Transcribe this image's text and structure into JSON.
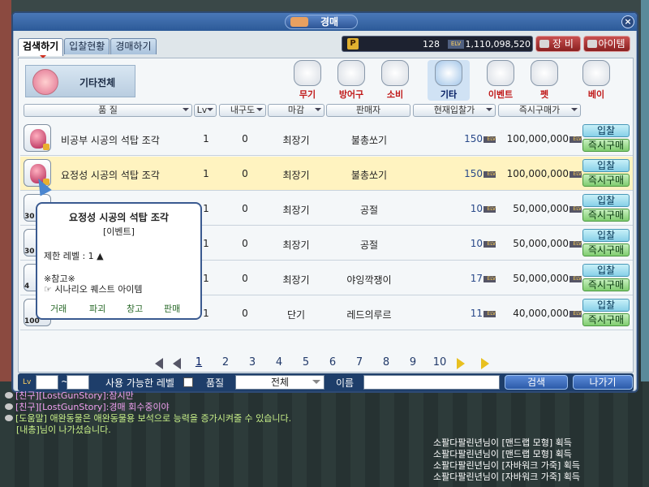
{
  "window": {
    "title": "경매"
  },
  "tabs": [
    {
      "label": "검색하기",
      "active": true
    },
    {
      "label": "입찰현황",
      "active": false
    },
    {
      "label": "경매하기",
      "active": false
    }
  ],
  "currency": {
    "pc_label": "P",
    "pc_value": "128",
    "meso_label": "ELV",
    "meso_value": "1,110,098,520"
  },
  "top_buttons": {
    "equip": "장 비",
    "item": "아이템"
  },
  "category_current": "기타전체",
  "categories": [
    {
      "label": "무기",
      "selected": false
    },
    {
      "label": "방어구",
      "selected": false
    },
    {
      "label": "소비",
      "selected": false
    },
    {
      "label": "기타",
      "selected": true
    },
    {
      "label": "이벤트",
      "selected": false
    },
    {
      "label": "펫",
      "selected": false
    },
    {
      "label": "베이",
      "selected": false
    }
  ],
  "columns": {
    "quality": "품 질",
    "lv": "Lv",
    "durability": "내구도",
    "deadline": "마감",
    "seller": "판매자",
    "bid_price": "현재입찰가",
    "buyout": "즉시구매가"
  },
  "rows": [
    {
      "name": "비공부 시공의 석탑 조각",
      "lv": "1",
      "dur": "0",
      "deadline": "최장기",
      "seller": "불총쏘기",
      "bid": "150",
      "buyout": "100,000,000",
      "icon_badge": ""
    },
    {
      "name": "요정성 시공의 석탑 조각",
      "lv": "1",
      "dur": "0",
      "deadline": "최장기",
      "seller": "불총쏘기",
      "bid": "150",
      "buyout": "100,000,000",
      "icon_badge": ""
    },
    {
      "name": "",
      "lv": "1",
      "dur": "0",
      "deadline": "최장기",
      "seller": "공절",
      "bid": "10",
      "buyout": "50,000,000",
      "icon_badge": "30"
    },
    {
      "name": "",
      "lv": "1",
      "dur": "0",
      "deadline": "최장기",
      "seller": "공절",
      "bid": "10",
      "buyout": "50,000,000",
      "icon_badge": "30"
    },
    {
      "name": "",
      "lv": "1",
      "dur": "0",
      "deadline": "최장기",
      "seller": "야잉깍쟁이",
      "bid": "17",
      "buyout": "50,000,000",
      "icon_badge": "4"
    },
    {
      "name": "",
      "lv": "1",
      "dur": "0",
      "deadline": "단기",
      "seller": "레드의루르",
      "bid": "11",
      "buyout": "40,000,000",
      "icon_badge": "100"
    }
  ],
  "row_buttons": {
    "bid": "입찰",
    "buy": "즉시구매"
  },
  "elv_badge": "ELV",
  "pagination": {
    "pages": [
      "1",
      "2",
      "3",
      "4",
      "5",
      "6",
      "7",
      "8",
      "9",
      "10"
    ],
    "current": "1"
  },
  "bottom": {
    "lv_label": "Lv",
    "level_label": "사용 가능한 레벨",
    "quality_label": "품질",
    "quality_value": "전체",
    "name_label": "이름",
    "search": "검색",
    "exit": "나가기"
  },
  "tooltip": {
    "title": "요정성 시공의 석탑 조각",
    "subtitle": "[이벤트]",
    "level": "제한 레벨 : 1 ▲",
    "note1": "※참고※",
    "note2": "☞ 시나리오 퀘스트 아이템",
    "actions": [
      "거래",
      "파괴",
      "창고",
      "판매"
    ]
  },
  "chat": [
    {
      "text": "[친구][LostGunStory]:잠시만",
      "color": "#f0a0f0"
    },
    {
      "text": "[친구][LostGunStory]:경매 회수중이야",
      "color": "#f0a0f0"
    },
    {
      "text": "[도움말] 애완동물은 애완동물용 보석으로 능력을 증가시켜줄 수 있습니다.",
      "color": "#c8f088"
    },
    {
      "text": "[내총]님이 나가셨습니다.",
      "color": "#c8f088"
    }
  ],
  "log": [
    "소팔다팔린년님이 [맨드랩 모형] 획득",
    "소팔다팔린년님이 [맨드랩 모형] 획득",
    "소팔다팔린년님이 [자바워크 가죽] 획득",
    "소팔다팔린년님이 [자바워크 가죽] 획득"
  ]
}
